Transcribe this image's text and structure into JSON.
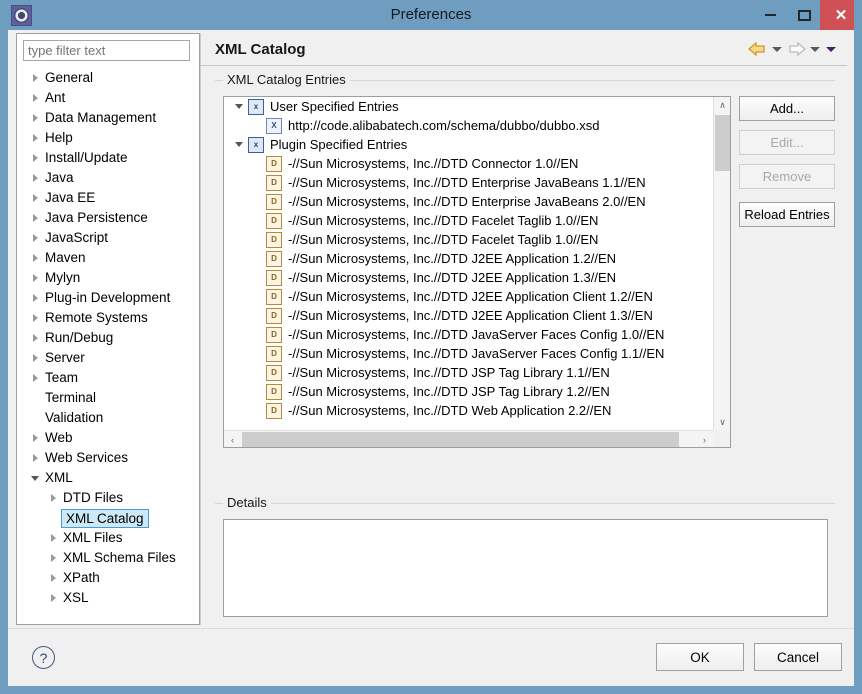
{
  "window": {
    "title": "Preferences",
    "app_icon": "gear-icon",
    "controls": {
      "minimize": "–",
      "maximize": "□",
      "close": "✕"
    },
    "accent_blue": "#6f9dc0",
    "close_red": "#cf5055"
  },
  "sidebar": {
    "filter_placeholder": "type filter text",
    "filter_value": "",
    "items": [
      {
        "label": "General",
        "indent": 0,
        "arrow": "collapsed",
        "selected": false
      },
      {
        "label": "Ant",
        "indent": 0,
        "arrow": "collapsed",
        "selected": false
      },
      {
        "label": "Data Management",
        "indent": 0,
        "arrow": "collapsed",
        "selected": false
      },
      {
        "label": "Help",
        "indent": 0,
        "arrow": "collapsed",
        "selected": false
      },
      {
        "label": "Install/Update",
        "indent": 0,
        "arrow": "collapsed",
        "selected": false
      },
      {
        "label": "Java",
        "indent": 0,
        "arrow": "collapsed",
        "selected": false
      },
      {
        "label": "Java EE",
        "indent": 0,
        "arrow": "collapsed",
        "selected": false
      },
      {
        "label": "Java Persistence",
        "indent": 0,
        "arrow": "collapsed",
        "selected": false
      },
      {
        "label": "JavaScript",
        "indent": 0,
        "arrow": "collapsed",
        "selected": false
      },
      {
        "label": "Maven",
        "indent": 0,
        "arrow": "collapsed",
        "selected": false
      },
      {
        "label": "Mylyn",
        "indent": 0,
        "arrow": "collapsed",
        "selected": false
      },
      {
        "label": "Plug-in Development",
        "indent": 0,
        "arrow": "collapsed",
        "selected": false
      },
      {
        "label": "Remote Systems",
        "indent": 0,
        "arrow": "collapsed",
        "selected": false
      },
      {
        "label": "Run/Debug",
        "indent": 0,
        "arrow": "collapsed",
        "selected": false
      },
      {
        "label": "Server",
        "indent": 0,
        "arrow": "collapsed",
        "selected": false
      },
      {
        "label": "Team",
        "indent": 0,
        "arrow": "collapsed",
        "selected": false
      },
      {
        "label": "Terminal",
        "indent": 0,
        "arrow": "none",
        "selected": false
      },
      {
        "label": "Validation",
        "indent": 0,
        "arrow": "none",
        "selected": false
      },
      {
        "label": "Web",
        "indent": 0,
        "arrow": "collapsed",
        "selected": false
      },
      {
        "label": "Web Services",
        "indent": 0,
        "arrow": "collapsed",
        "selected": false
      },
      {
        "label": "XML",
        "indent": 0,
        "arrow": "expanded",
        "selected": false
      },
      {
        "label": "DTD Files",
        "indent": 1,
        "arrow": "collapsed",
        "selected": false
      },
      {
        "label": "XML Catalog",
        "indent": 1,
        "arrow": "none",
        "selected": true
      },
      {
        "label": "XML Files",
        "indent": 1,
        "arrow": "collapsed",
        "selected": false
      },
      {
        "label": "XML Schema Files",
        "indent": 1,
        "arrow": "collapsed",
        "selected": false
      },
      {
        "label": "XPath",
        "indent": 1,
        "arrow": "collapsed",
        "selected": false
      },
      {
        "label": "XSL",
        "indent": 1,
        "arrow": "collapsed",
        "selected": false
      }
    ]
  },
  "page": {
    "title": "XML Catalog",
    "nav": {
      "back_icon": "back-arrow-icon",
      "back_enabled": true,
      "back_caret_icon": "chevron-down-icon",
      "forward_icon": "forward-arrow-icon",
      "forward_enabled": false,
      "forward_caret_icon": "chevron-down-icon",
      "menu_caret_icon": "chevron-down-icon",
      "back_color": "#e0a32e",
      "forward_color": "#c9c9c9",
      "menu_color": "#4b1f6f"
    }
  },
  "entries_group": {
    "label": "XML Catalog Entries",
    "tree": [
      {
        "label": "User Specified Entries",
        "level": 0,
        "icon": "xml-catalog-group-icon",
        "icon_glyph": "x",
        "icon_kind": "group",
        "expanded": true
      },
      {
        "label": "http://code.alibabatech.com/schema/dubbo/dubbo.xsd",
        "level": 1,
        "icon": "xsd-entry-icon",
        "icon_glyph": "X",
        "icon_kind": "xsd",
        "expanded": null
      },
      {
        "label": "Plugin Specified Entries",
        "level": 0,
        "icon": "xml-catalog-group-icon",
        "icon_glyph": "x",
        "icon_kind": "group",
        "expanded": true
      },
      {
        "label": "-//Sun Microsystems, Inc.//DTD Connector 1.0//EN",
        "level": 1,
        "icon": "dtd-entry-icon",
        "icon_glyph": "D",
        "icon_kind": "dtd",
        "expanded": null
      },
      {
        "label": "-//Sun Microsystems, Inc.//DTD Enterprise JavaBeans 1.1//EN",
        "level": 1,
        "icon": "dtd-entry-icon",
        "icon_glyph": "D",
        "icon_kind": "dtd",
        "expanded": null
      },
      {
        "label": "-//Sun Microsystems, Inc.//DTD Enterprise JavaBeans 2.0//EN",
        "level": 1,
        "icon": "dtd-entry-icon",
        "icon_glyph": "D",
        "icon_kind": "dtd",
        "expanded": null
      },
      {
        "label": "-//Sun Microsystems, Inc.//DTD Facelet Taglib 1.0//EN",
        "level": 1,
        "icon": "dtd-entry-icon",
        "icon_glyph": "D",
        "icon_kind": "dtd",
        "expanded": null
      },
      {
        "label": "-//Sun Microsystems, Inc.//DTD Facelet Taglib 1.0//EN",
        "level": 1,
        "icon": "dtd-entry-icon",
        "icon_glyph": "D",
        "icon_kind": "dtd",
        "expanded": null
      },
      {
        "label": "-//Sun Microsystems, Inc.//DTD J2EE Application 1.2//EN",
        "level": 1,
        "icon": "dtd-entry-icon",
        "icon_glyph": "D",
        "icon_kind": "dtd",
        "expanded": null
      },
      {
        "label": "-//Sun Microsystems, Inc.//DTD J2EE Application 1.3//EN",
        "level": 1,
        "icon": "dtd-entry-icon",
        "icon_glyph": "D",
        "icon_kind": "dtd",
        "expanded": null
      },
      {
        "label": "-//Sun Microsystems, Inc.//DTD J2EE Application Client 1.2//EN",
        "level": 1,
        "icon": "dtd-entry-icon",
        "icon_glyph": "D",
        "icon_kind": "dtd",
        "expanded": null
      },
      {
        "label": "-//Sun Microsystems, Inc.//DTD J2EE Application Client 1.3//EN",
        "level": 1,
        "icon": "dtd-entry-icon",
        "icon_glyph": "D",
        "icon_kind": "dtd",
        "expanded": null
      },
      {
        "label": "-//Sun Microsystems, Inc.//DTD JavaServer Faces Config 1.0//EN",
        "level": 1,
        "icon": "dtd-entry-icon",
        "icon_glyph": "D",
        "icon_kind": "dtd",
        "expanded": null
      },
      {
        "label": "-//Sun Microsystems, Inc.//DTD JavaServer Faces Config 1.1//EN",
        "level": 1,
        "icon": "dtd-entry-icon",
        "icon_glyph": "D",
        "icon_kind": "dtd",
        "expanded": null
      },
      {
        "label": "-//Sun Microsystems, Inc.//DTD JSP Tag Library 1.1//EN",
        "level": 1,
        "icon": "dtd-entry-icon",
        "icon_glyph": "D",
        "icon_kind": "dtd",
        "expanded": null
      },
      {
        "label": "-//Sun Microsystems, Inc.//DTD JSP Tag Library 1.2//EN",
        "level": 1,
        "icon": "dtd-entry-icon",
        "icon_glyph": "D",
        "icon_kind": "dtd",
        "expanded": null
      },
      {
        "label": "-//Sun Microsystems, Inc.//DTD Web Application 2.2//EN",
        "level": 1,
        "icon": "dtd-entry-icon",
        "icon_glyph": "D",
        "icon_kind": "dtd",
        "expanded": null
      }
    ],
    "buttons": [
      {
        "label": "Add...",
        "enabled": true
      },
      {
        "label": "Edit...",
        "enabled": false
      },
      {
        "label": "Remove",
        "enabled": false
      },
      {
        "label": "Reload Entries",
        "enabled": true
      }
    ],
    "scroll": {
      "vertical_up": "∧",
      "vertical_down": "∨",
      "horizontal_left": "‹",
      "horizontal_right": "›"
    }
  },
  "details_group": {
    "label": "Details",
    "content": "",
    "scroll": {
      "vertical_up": "∧",
      "vertical_down": "∨",
      "horizontal_left": "‹",
      "horizontal_right": "›"
    }
  },
  "footer": {
    "help_icon": "help-question-icon",
    "help_glyph": "?",
    "ok_label": "OK",
    "cancel_label": "Cancel"
  }
}
